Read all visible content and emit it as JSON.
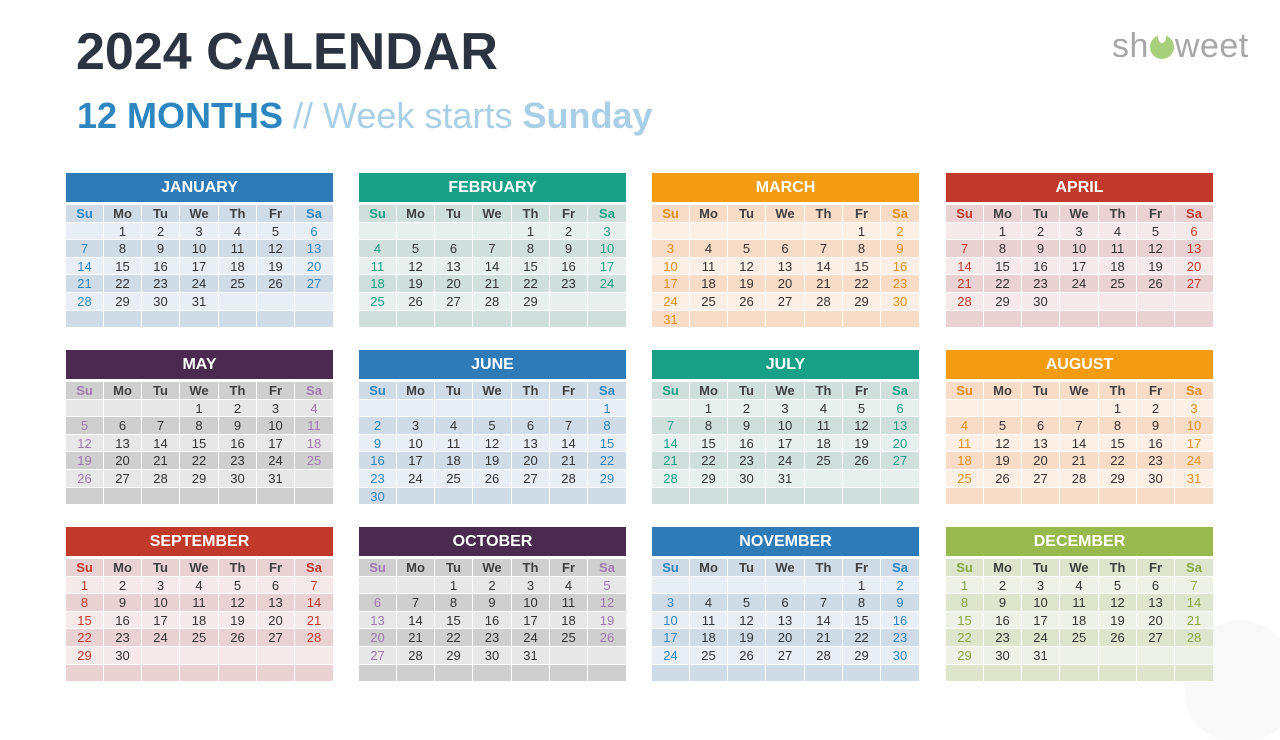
{
  "title": "2024 CALENDAR",
  "subtitle": {
    "strong": "12 MONTHS",
    "middle": " // Week starts ",
    "end": "Sunday"
  },
  "logo": {
    "left": "sh",
    "right": "weet",
    "icon": "leaf-o-icon"
  },
  "weekdays": [
    "Su",
    "Mo",
    "Tu",
    "We",
    "Th",
    "Fr",
    "Sa"
  ],
  "months": [
    {
      "name": "JANUARY",
      "start": 1,
      "days": 31,
      "color": "#2e7bb8",
      "accent": "#2e86c1",
      "light": "#e9eef4",
      "dark": "#cfdbe7"
    },
    {
      "name": "FEBRUARY",
      "start": 4,
      "days": 29,
      "color": "#17a085",
      "accent": "#17a085",
      "light": "#e8f0ee",
      "dark": "#cfe0dc"
    },
    {
      "name": "MARCH",
      "start": 5,
      "days": 31,
      "color": "#f39c12",
      "accent": "#e08c10",
      "light": "#fcefe6",
      "dark": "#f8dcc8"
    },
    {
      "name": "APRIL",
      "start": 1,
      "days": 30,
      "color": "#c0392b",
      "accent": "#c0392b",
      "light": "#f5e9ea",
      "dark": "#ead2d4"
    },
    {
      "name": "MAY",
      "start": 3,
      "days": 31,
      "color": "#4a2a4f",
      "accent": "#a07ab0",
      "light": "#e7e7e7",
      "dark": "#cfcfcf"
    },
    {
      "name": "JUNE",
      "start": 6,
      "days": 30,
      "color": "#2e7bb8",
      "accent": "#2e86c1",
      "light": "#e9eef4",
      "dark": "#cfdbe7"
    },
    {
      "name": "JULY",
      "start": 1,
      "days": 31,
      "color": "#17a085",
      "accent": "#17a085",
      "light": "#e8f0ee",
      "dark": "#cfe0dc"
    },
    {
      "name": "AUGUST",
      "start": 4,
      "days": 31,
      "color": "#f39c12",
      "accent": "#e08c10",
      "light": "#fcefe6",
      "dark": "#f8dcc8"
    },
    {
      "name": "SEPTEMBER",
      "start": 0,
      "days": 30,
      "color": "#c0392b",
      "accent": "#c0392b",
      "light": "#f5e9ea",
      "dark": "#ead2d4"
    },
    {
      "name": "OCTOBER",
      "start": 2,
      "days": 31,
      "color": "#4a2a4f",
      "accent": "#a07ab0",
      "light": "#e7e7e7",
      "dark": "#cfcfcf"
    },
    {
      "name": "NOVEMBER",
      "start": 5,
      "days": 30,
      "color": "#2e7bb8",
      "accent": "#2e86c1",
      "light": "#e9eef4",
      "dark": "#cfdbe7"
    },
    {
      "name": "DECEMBER",
      "start": 0,
      "days": 31,
      "color": "#97b94e",
      "accent": "#8aa64a",
      "light": "#eef2e6",
      "dark": "#dde6cc"
    }
  ]
}
